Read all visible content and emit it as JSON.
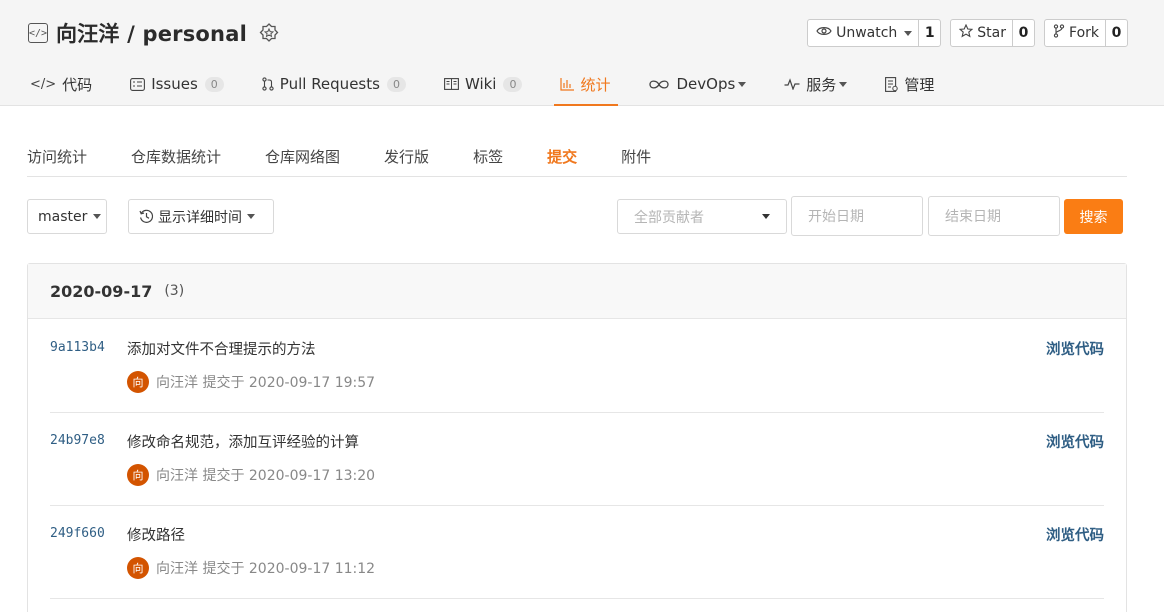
{
  "repo": {
    "title": "向汪洋 / personal",
    "icon": "code-icon"
  },
  "actions": {
    "watch": {
      "label": "Unwatch",
      "count": "1"
    },
    "star": {
      "label": "Star",
      "count": "0"
    },
    "fork": {
      "label": "Fork",
      "count": "0"
    }
  },
  "nav": {
    "code": "代码",
    "issues": "Issues",
    "issues_count": "0",
    "pulls": "Pull Requests",
    "pulls_count": "0",
    "wiki": "Wiki",
    "wiki_count": "0",
    "stats": "统计",
    "devops": "DevOps",
    "services": "服务",
    "manage": "管理"
  },
  "subnav": [
    "访问统计",
    "仓库数据统计",
    "仓库网络图",
    "发行版",
    "标签",
    "提交",
    "附件"
  ],
  "subnav_active": "提交",
  "filters": {
    "branch": "master",
    "time_mode": "显示详细时间",
    "contributor_placeholder": "全部贡献者",
    "start_placeholder": "开始日期",
    "end_placeholder": "结束日期",
    "search": "搜索"
  },
  "group": {
    "date": "2020-09-17",
    "count": "(3)"
  },
  "commits": [
    {
      "sha": "9a113b4",
      "message": "添加对文件不合理提示的方法",
      "author_initial": "向",
      "meta": "向汪洋 提交于 2020-09-17 19:57",
      "browse": "浏览代码"
    },
    {
      "sha": "24b97e8",
      "message": "修改命名规范，添加互评经验的计算",
      "author_initial": "向",
      "meta": "向汪洋 提交于 2020-09-17 13:20",
      "browse": "浏览代码"
    },
    {
      "sha": "249f660",
      "message": "修改路径",
      "author_initial": "向",
      "meta": "向汪洋 提交于 2020-09-17 11:12",
      "browse": "浏览代码"
    }
  ],
  "colors": {
    "accent": "#f0781e",
    "link": "#2f5e84",
    "avatar": "#d35400"
  }
}
